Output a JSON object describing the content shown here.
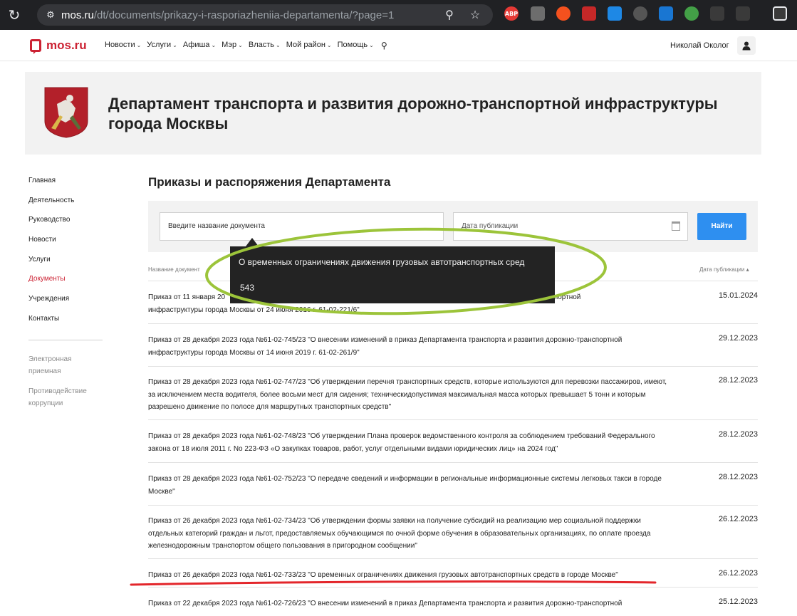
{
  "browser": {
    "url_host": "mos.ru",
    "url_path": "/dt/documents/prikazy-i-rasporiazheniia-departamenta/?page=1",
    "extensions": [
      "ABP"
    ]
  },
  "site": {
    "logo_text": "mos.ru",
    "nav": [
      {
        "label": "Новости"
      },
      {
        "label": "Услуги"
      },
      {
        "label": "Афиша"
      },
      {
        "label": "Мэр"
      },
      {
        "label": "Власть"
      },
      {
        "label": "Мой район"
      },
      {
        "label": "Помощь"
      }
    ],
    "user_name": "Николай Околог"
  },
  "department": {
    "title": "Департамент транспорта и развития дорожно-транспортной инфраструктуры города Москвы"
  },
  "left_menu": {
    "items": [
      {
        "label": "Главная"
      },
      {
        "label": "Деятельность"
      },
      {
        "label": "Руководство"
      },
      {
        "label": "Новости"
      },
      {
        "label": "Услуги"
      },
      {
        "label": "Документы"
      },
      {
        "label": "Учреждения"
      },
      {
        "label": "Контакты"
      }
    ],
    "secondary": [
      {
        "label": "Электронная приемная"
      },
      {
        "label": "Противодействие коррупции"
      }
    ]
  },
  "main": {
    "page_title": "Приказы и распоряжения Департамента",
    "search": {
      "name_placeholder": "Введите название документа",
      "date_placeholder": "Дата публикации",
      "button_label": "Найти"
    },
    "columns": {
      "name": "Название документ",
      "date": "Дата публикации"
    },
    "documents": [
      {
        "title": "Приказ от 11 января 20",
        "title_tail": "дорожно-транспортной",
        "line2": "инфраструктуры города Москвы от 24 июня 2016 г. 61-02-221/6\"",
        "date": "15.01.2024"
      },
      {
        "title": "Приказ от 28 декабря 2023 года №61-02-745/23 \"О внесении изменений в приказ Департамента транспорта и развития дорожно-транспортной инфраструктуры города Москвы от 14 июня 2019 г. 61-02-261/9\"",
        "date": "29.12.2023"
      },
      {
        "title": "Приказ от 28 декабря 2023 года №61-02-747/23 \"Об утверждении перечня транспортных средств, которые используются для перевозки пассажиров, имеют, за исключением места водителя, более восьми мест для сидения; техническидопустимая максимальная масса которых превышает 5 тонн и которым разрешено движение по полосе для маршрутных транспортных средств\"",
        "date": "28.12.2023"
      },
      {
        "title": "Приказ от 28 декабря 2023 года №61-02-748/23 \"Об утверждении Плана проверок ведомственного контроля за соблюдением требований Федерального закона от 18 июля 2011 г. No 223-ФЗ «О закупках товаров, работ, услуг отдельными видами юридических лиц» на 2024 год\"",
        "date": "28.12.2023"
      },
      {
        "title": "Приказ от 28 декабря 2023 года №61-02-752/23 \"О передаче сведений и информации в региональные информационные системы легковых такси в городе Москве\"",
        "date": "28.12.2023"
      },
      {
        "title": "Приказ от 26 декабря 2023 года №61-02-734/23 \"Об утверждении формы заявки на получение субсидий на реализацию мер социальной поддержки отдельных категорий граждан и льгот, предоставляемых обучающимся по очной форме обучения в образовательных организациях, по оплате проезда железнодорожным транспортом общего пользования в пригородном сообщении\"",
        "date": "26.12.2023"
      },
      {
        "title": "Приказ от 26 декабря 2023 года №61-02-733/23 \"О временных ограничениях движения грузовых автотранспортных средств в городе Москве\"",
        "date": "26.12.2023"
      },
      {
        "title": "Приказ от 22 декабря 2023 года №61-02-726/23 \"О внесении изменений в приказ Департамента транспорта и развития дорожно-транспортной",
        "date": "25.12.2023"
      }
    ]
  },
  "tooltip": {
    "title": "О временных ограничениях движения грузовых автотранспортных сред",
    "count": "543"
  },
  "annotations": {
    "ellipse_color": "#9cc43a",
    "underline_color": "#e3262b"
  }
}
